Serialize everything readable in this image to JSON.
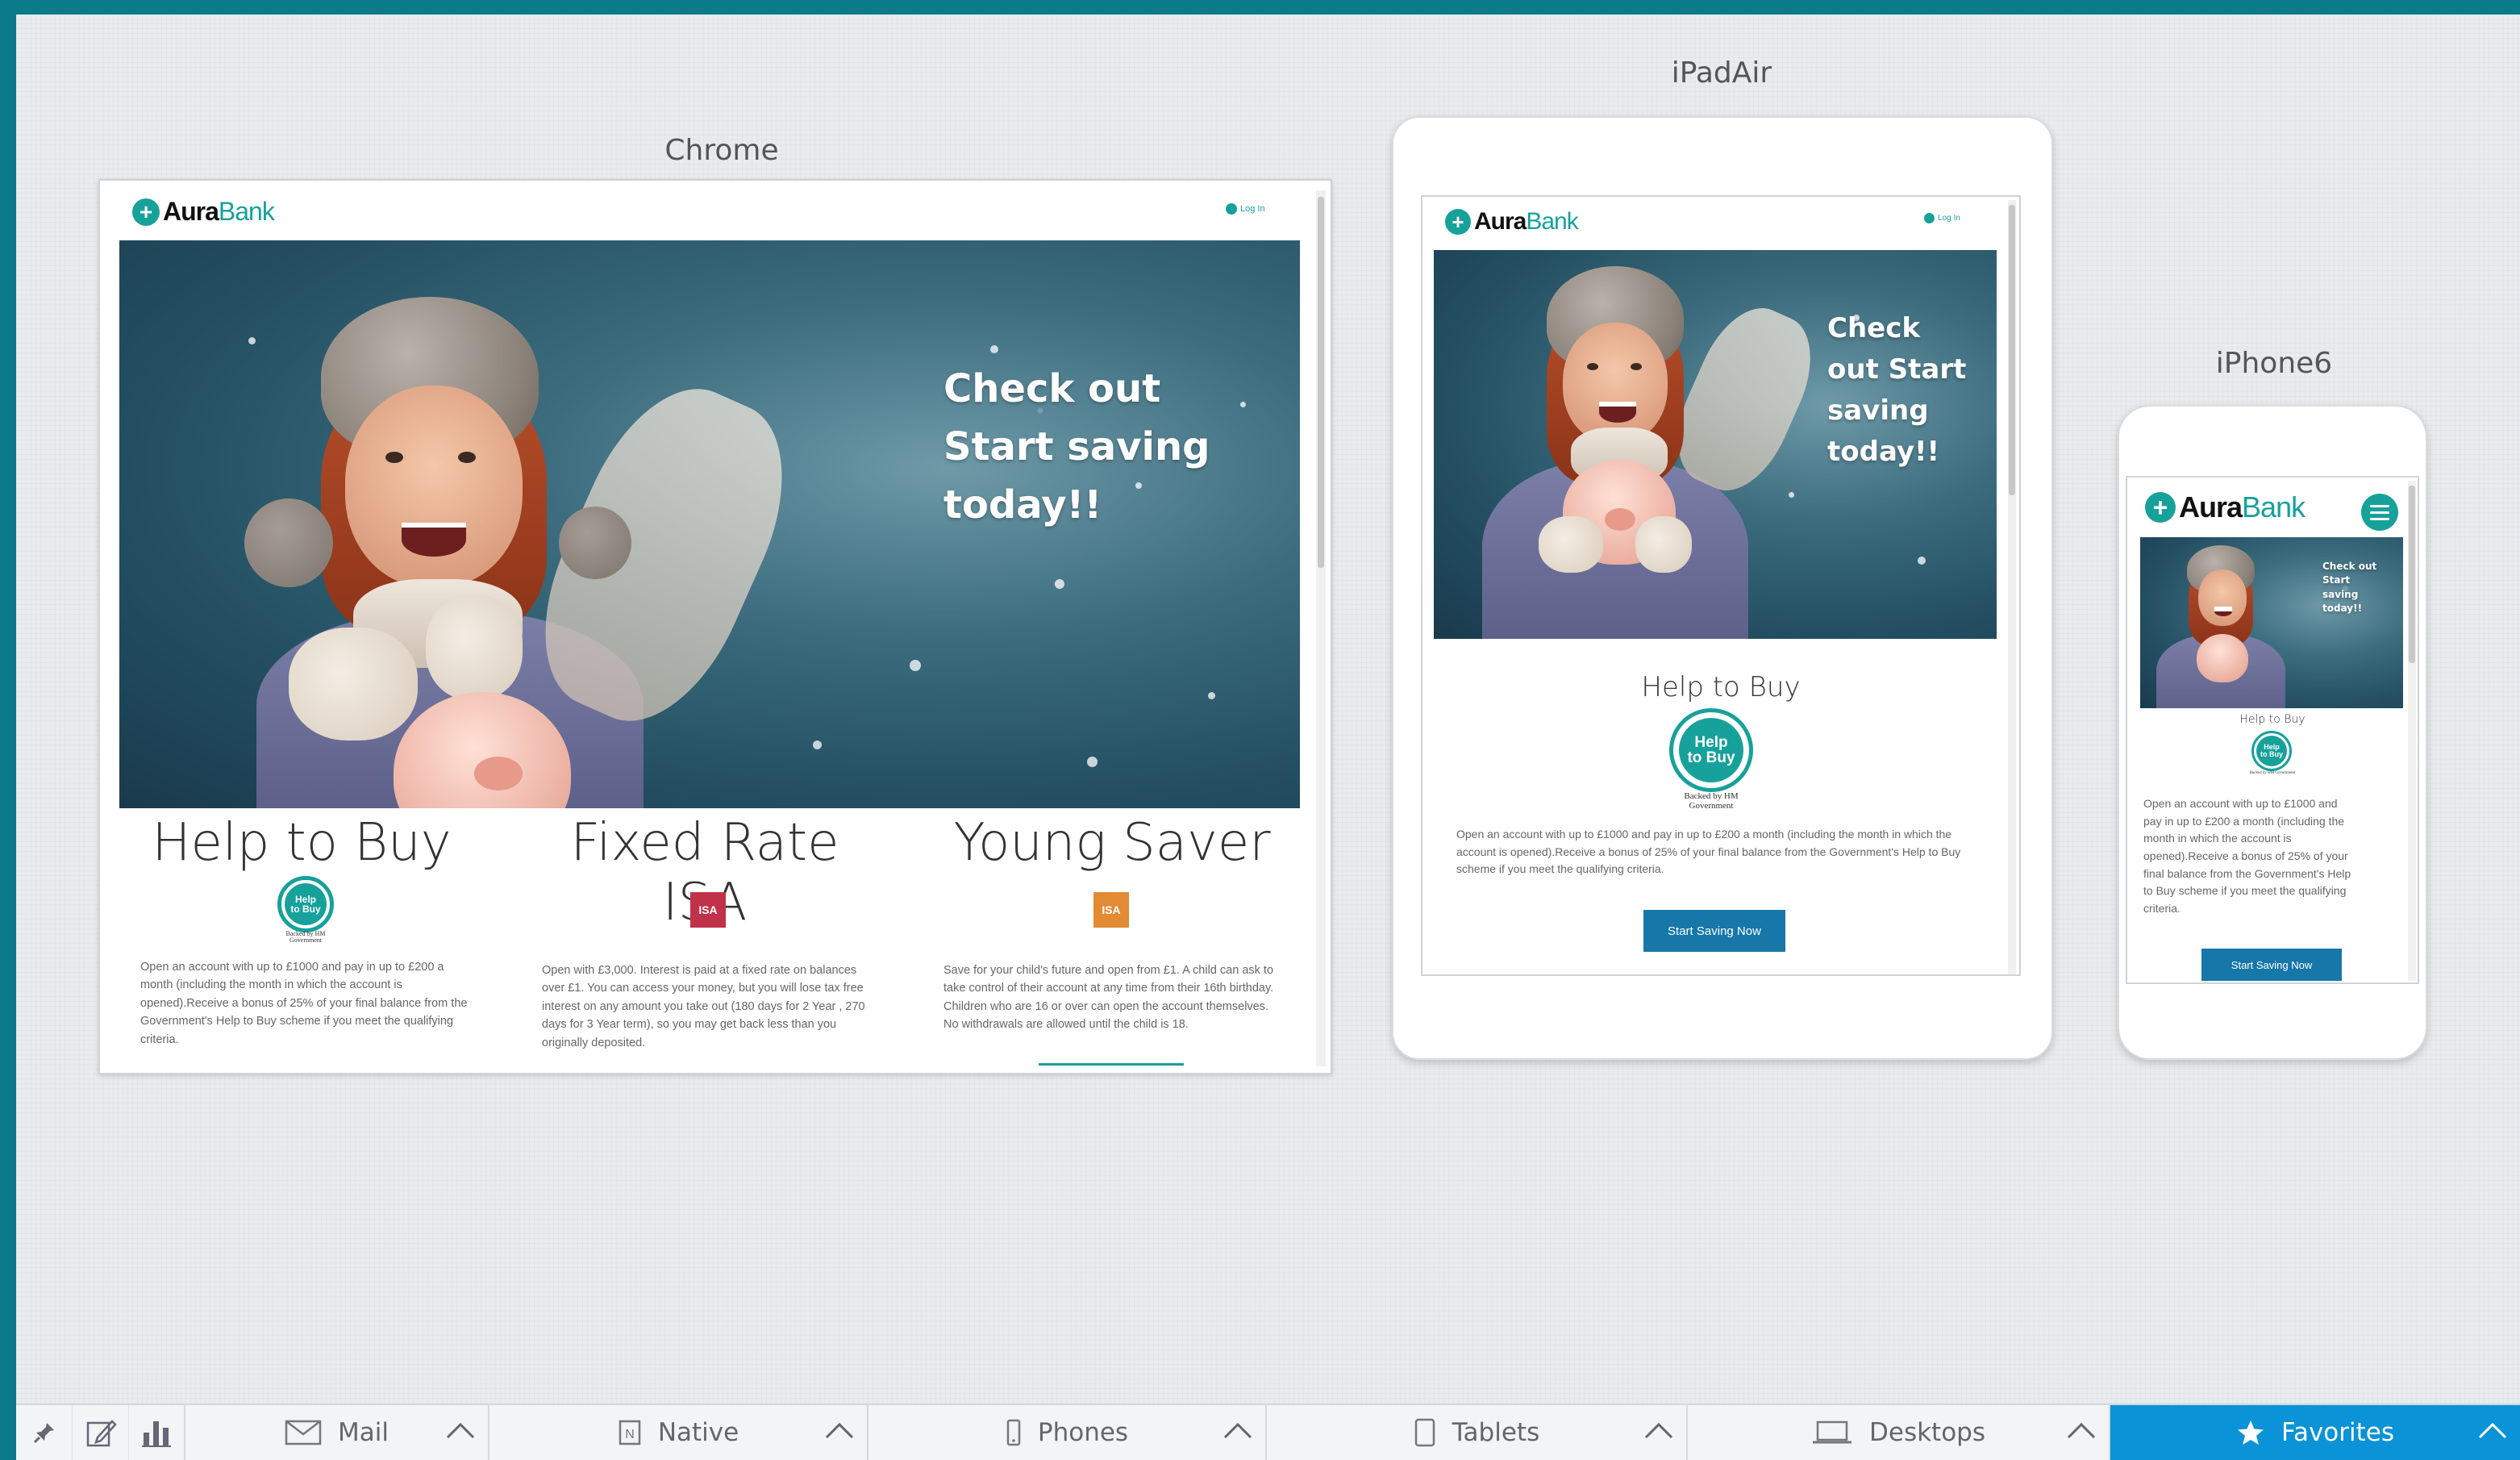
{
  "devices": {
    "chrome": {
      "label": "Chrome"
    },
    "ipad": {
      "label": "iPadAir"
    },
    "iphone": {
      "label": "iPhone6"
    }
  },
  "site": {
    "logo_aura": "Aura",
    "logo_bank": "Bank",
    "login": "Log In",
    "hero_text_desktop": "Check out Start saving today!!",
    "hero_text_tablet": "Check out Start saving today!!",
    "hero_text_phone": "Check out Start saving today!!",
    "products": [
      {
        "title": "Help to Buy",
        "body": "Open an account with up to £1000 and pay in up to £200 a month (including the month in which the account is opened).Receive a bonus of 25% of your final balance from the Government's Help to Buy scheme if you meet the qualifying criteria.",
        "badge_line1": "Help",
        "badge_line2": "to Buy",
        "backed": "Backed by HM Government"
      },
      {
        "title": "Fixed Rate ISA",
        "body": "Open with £3,000. Interest is paid at a fixed rate on balances over £1. You can access your money, but you will lose tax free interest on any amount you take out (180 days for 2 Year , 270 days for 3 Year term), so you may get back less than you originally deposited.",
        "icon_text": "ISA"
      },
      {
        "title": "Young Saver",
        "body": "Save for your child's future and open from £1. A child can ask to take control of their account at any time from their 16th birthday. Children who are 16 or over can open the account themselves. No withdrawals are allowed until the child is 18.",
        "icon_text": "ISA"
      }
    ],
    "tablet_body": "Open an account with up to £1000 and pay in up to £200 a month (including the month in which the account is opened).Receive a bonus of 25% of your final balance from the Government's Help to Buy scheme if you meet the qualifying criteria.",
    "phone_body": "Open an account with up to £1000 and pay in up to £200 a month (including the month in which the account is opened).Receive a bonus of 25% of your final balance from the Government's Help to Buy scheme if you meet the qualifying criteria.",
    "cta": "Start Saving Now"
  },
  "toolbar": {
    "mail": "Mail",
    "native": "Native",
    "phones": "Phones",
    "tablets": "Tablets",
    "desktops": "Desktops",
    "favorites": "Favorites"
  },
  "colors": {
    "accent": "#17a19b",
    "frame": "#0b7b8c",
    "button": "#1677a8",
    "favorites": "#0a93d6",
    "isa_red": "#c0324a",
    "isa_orange": "#e28b33"
  }
}
